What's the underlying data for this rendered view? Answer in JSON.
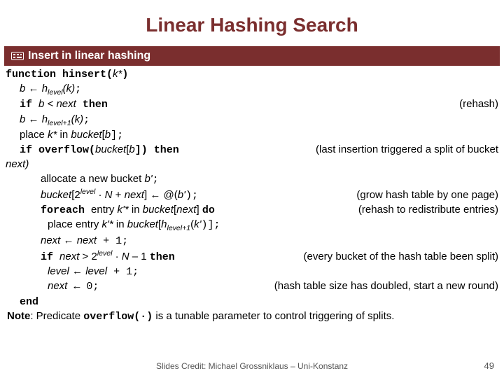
{
  "title": "Linear Hashing Search",
  "section": "Insert in linear hashing",
  "code": {
    "l1a": "function hinsert(",
    "l1b": "k*",
    "l1c": ")",
    "l2a": "b",
    "l2arrow": " ← ",
    "l2b": "h",
    "l2sub": "level",
    "l2c": "(k)",
    "l2d": ";",
    "l3a": "if ",
    "l3b": "b < next",
    "l3c": " then",
    "l3comment": "(rehash)",
    "l4a": "b",
    "l4b": " ← ",
    "l4c": "h",
    "l4sub": "level+1",
    "l4d": "(k)",
    "l4e": ";",
    "l5a": "place ",
    "l5b": "k*",
    "l5c": " in ",
    "l5d": "bucket",
    "l5e": "[",
    "l5f": "b",
    "l5g": "];",
    "l6a": "if overflow(",
    "l6b": "bucket",
    "l6c": "[",
    "l6d": "b",
    "l6e": "]) then",
    "l6comment": "(last insertion triggered a split of bucket",
    "l6comment2": "next)",
    "l7a": "allocate a new bucket ",
    "l7b": "b'",
    "l7c": ";",
    "l8a": "bucket",
    "l8b": "[2",
    "l8sup": "level",
    "l8c": " · ",
    "l8d": "N",
    "l8e": " + ",
    "l8f": "next",
    "l8g": "] ← @(",
    "l8h": "b'",
    "l8i": ");",
    "l8comment": "(grow hash table by one page)",
    "l9a": "foreach ",
    "l9b": "entry ",
    "l9c": "k'*",
    "l9d": " in ",
    "l9e": "bucket",
    "l9f": "[",
    "l9g": "next",
    "l9h": "] ",
    "l9i": "do",
    "l9comment": "(rehash to redistribute entries)",
    "l10a": "place entry ",
    "l10b": "k'*",
    "l10c": " in ",
    "l10d": "bucket",
    "l10e": "[",
    "l10f": "h",
    "l10sub": "level+1",
    "l10g": "(",
    "l10h": "k'",
    "l10i": ")];",
    "l11a": "next",
    "l11b": " ← ",
    "l11c": "next",
    "l11d": " + 1;",
    "l12a": "if ",
    "l12b": "next",
    "l12c": " > 2",
    "l12sup": "level",
    "l12d": " · ",
    "l12e": "N",
    "l12f": " – 1 ",
    "l12g": "then",
    "l12comment": "(every bucket of the hash table been split)",
    "l13a": "level",
    "l13b": " ← ",
    "l13c": "level",
    "l13d": " + 1;",
    "l14a": "next",
    "l14b": " ← 0;",
    "l14comment": "(hash table size has doubled, start a new round)",
    "l15": "end"
  },
  "note_label": "Note",
  "note_text1": ": Predicate ",
  "note_code": "overflow(·)",
  "note_text2": " is a tunable parameter to control triggering of splits.",
  "credit": "Slides Credit: Michael Grossniklaus – Uni-Konstanz",
  "pagenum": "49"
}
